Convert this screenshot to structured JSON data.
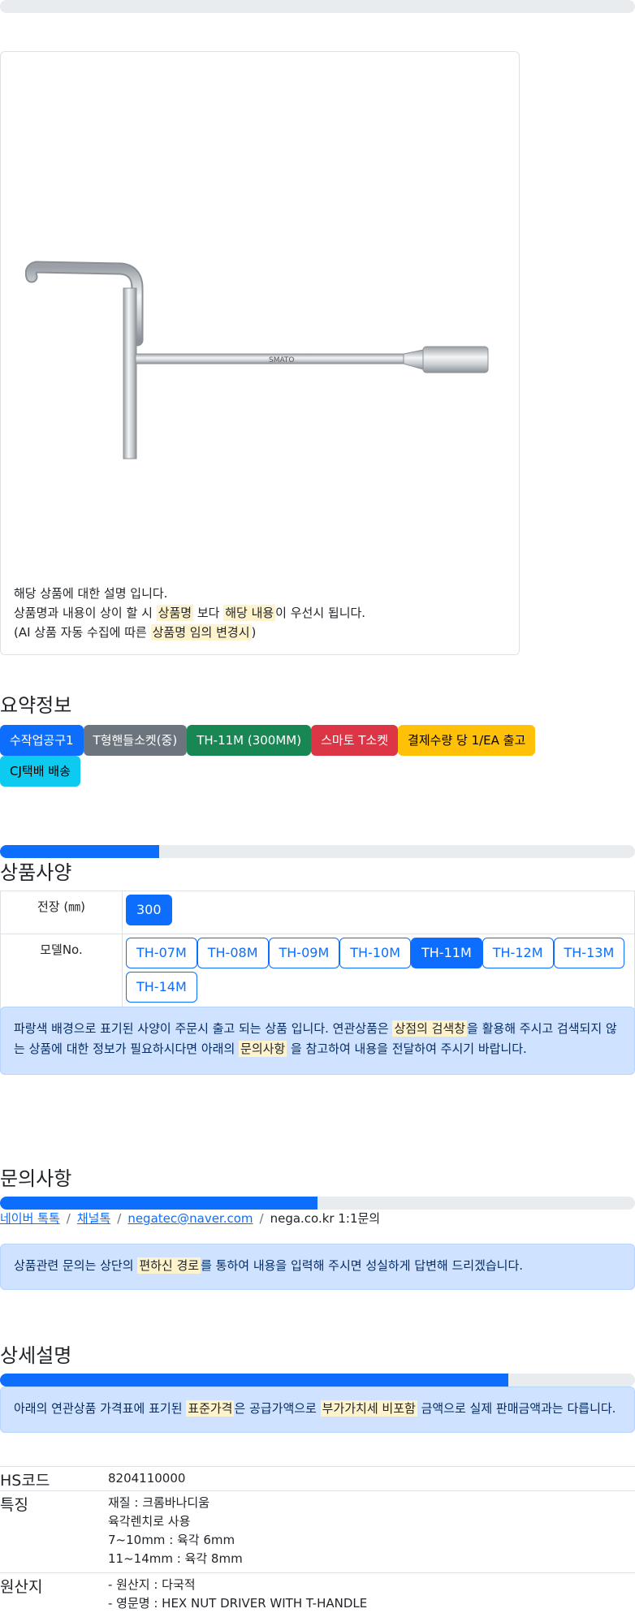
{
  "card": {
    "desc_line1": "해당 상품에 대한 설명 입니다.",
    "desc_line2_pre": "상품명과 내용이 상이 할 시 ",
    "desc_line2_mark1": "상품명",
    "desc_line2_mid": " 보다 ",
    "desc_line2_mark2": "해당 내용",
    "desc_line2_post": "이 우선시 됩니다.",
    "desc_line3_pre": "(AI 상품 자동 수집에 따른 ",
    "desc_line3_mark": "상품명 임의 변경시",
    "desc_line3_post": ")",
    "product_brand": "SMATO"
  },
  "summary": {
    "title": "요약정보",
    "badges": [
      {
        "label": "수작업공구1",
        "color": "#0d6efd",
        "text_color": "#ffffff"
      },
      {
        "label": "T형핸들소켓(중)",
        "color": "#6c757d",
        "text_color": "#ffffff"
      },
      {
        "label": "TH-11M (300MM)",
        "color": "#198754",
        "text_color": "#ffffff"
      },
      {
        "label": "스마토 T소켓",
        "color": "#dc3545",
        "text_color": "#ffffff"
      },
      {
        "label": "결제수량 당 1/EA 출고",
        "color": "#ffc107",
        "text_color": "#000000"
      },
      {
        "label": "CJ택배 배송",
        "color": "#0dcaf0",
        "text_color": "#000000"
      }
    ]
  },
  "spec": {
    "title": "상품사양",
    "progress": 0.25,
    "rows": [
      {
        "label": "전장 (㎜)",
        "options": [
          "300"
        ],
        "selected": "300"
      },
      {
        "label": "모델No.",
        "options": [
          "TH-07M",
          "TH-08M",
          "TH-09M",
          "TH-10M",
          "TH-11M",
          "TH-12M",
          "TH-13M",
          "TH-14M"
        ],
        "selected": "TH-11M"
      }
    ],
    "alert_pre": "파랑색 배경으로 표기된 사양이 주문시 출고 되는 상품 입니다. 연관상품은 ",
    "alert_mark1": "상점의 검색창",
    "alert_mid": "을 활용해 주시고 검색되지 않는 상품에 대한 정보가 필요하시다면 아래의 ",
    "alert_mark2": "문의사항",
    "alert_post": " 을 참고하여 내용을 전달하여 주시기 바랍니다."
  },
  "inquiry": {
    "title": "문의사항",
    "progress": 0.5,
    "links": [
      "네이버 톡톡",
      "채널톡",
      "negatec@naver.com"
    ],
    "last": "nega.co.kr 1:1문의",
    "alert_pre": "상품관련 문의는 상단의 ",
    "alert_mark": "편하신 경로",
    "alert_post": "를 통하여 내용을 입력해 주시면 성실하게 답변해 드리겠습니다."
  },
  "detail": {
    "title": "상세설명",
    "progress": 0.8,
    "alert_pre": "아래의 연관상품 가격표에 표기된 ",
    "alert_mark1": "표준가격",
    "alert_mid": "은 공급가액으로 ",
    "alert_mark2": "부가가치세 비포함",
    "alert_post": " 금액으로 실제 판매금액과는 다릅니다.",
    "rows": [
      {
        "key": "HS코드",
        "values": [
          "8204110000"
        ]
      },
      {
        "key": "특징",
        "values": [
          "재질 : 크롬바나디움",
          "육각렌치로 사용",
          "7~10mm : 육각 6mm",
          "11~14mm : 육각 8mm"
        ]
      },
      {
        "key": "원산지",
        "values": [
          "- 원산지 : 다국적",
          "- 영문명 : HEX NUT DRIVER WITH T-HANDLE"
        ]
      }
    ]
  }
}
